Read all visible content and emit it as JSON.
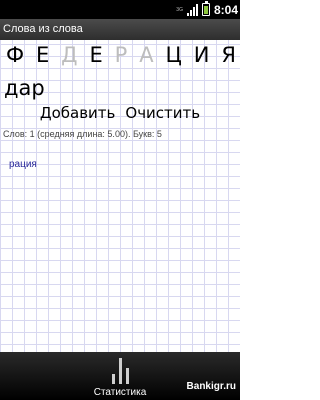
{
  "status": {
    "network": "3G",
    "battery": "battery-charging",
    "time": "8:04"
  },
  "app": {
    "title": "Слова из слова"
  },
  "letters": [
    "Ф",
    "Е",
    "Д",
    "Е",
    "Р",
    "А",
    "Ц",
    "И",
    "Я"
  ],
  "letter_states": [
    "dark",
    "dark",
    "dim",
    "dark",
    "dim",
    "dim",
    "dark",
    "dark",
    "dark"
  ],
  "current_word": "дар",
  "actions": {
    "add": "Добавить",
    "clear": "Очистить"
  },
  "stats_line": "Слов: 1 (средняя длина: 5.00). Букв: 5",
  "found_words": [
    "рация"
  ],
  "bottom": {
    "statistics_label": "Статистика",
    "watermark": "Bankigr.ru"
  },
  "colors": {
    "grid_line": "#d8d8f0",
    "found_word": "#2a2a9a",
    "dim_letter": "#bdbdbd"
  }
}
